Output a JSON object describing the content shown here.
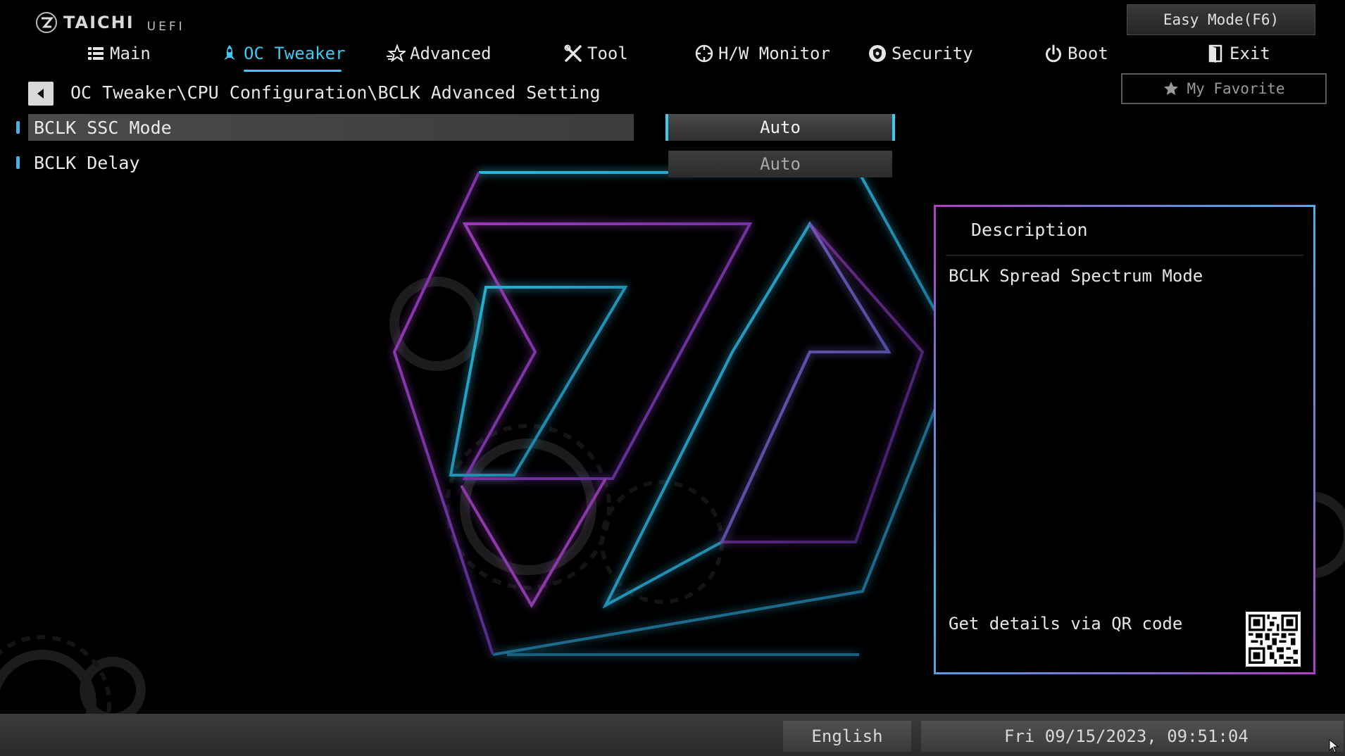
{
  "brand": {
    "name": "TAICHI",
    "sub": "UEFI"
  },
  "easy_mode_label": "Easy Mode(F6)",
  "favorite_label": "My Favorite",
  "nav": {
    "main": "Main",
    "oc_tweaker": "OC Tweaker",
    "advanced": "Advanced",
    "tool": "Tool",
    "hw_monitor": "H/W Monitor",
    "security": "Security",
    "boot": "Boot",
    "exit": "Exit",
    "active": "OC Tweaker"
  },
  "breadcrumb": "OC Tweaker\\CPU Configuration\\BCLK Advanced Setting",
  "settings": [
    {
      "label": "BCLK SSC Mode",
      "value": "Auto",
      "selected": true
    },
    {
      "label": "BCLK Delay",
      "value": "Auto",
      "selected": false
    }
  ],
  "description": {
    "title": "Description",
    "text": "BCLK Spread Spectrum Mode",
    "qr_label": "Get details via QR code"
  },
  "footer": {
    "language": "English",
    "datetime": "Fri 09/15/2023, 09:51:04"
  },
  "colors": {
    "accent": "#3fc8f0",
    "panel_border_pink": "#b03cc8",
    "background": "#000000"
  }
}
